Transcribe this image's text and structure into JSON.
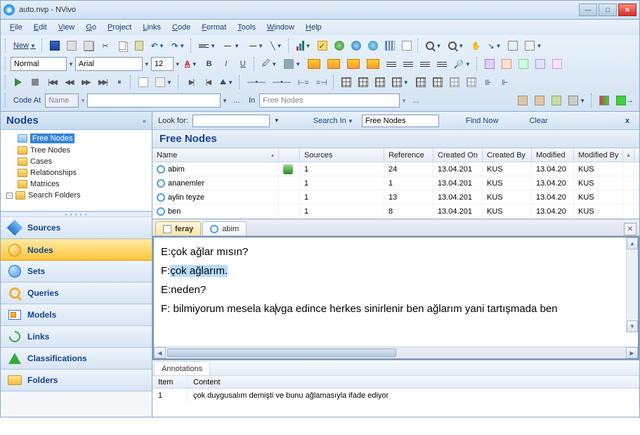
{
  "title": "auto.nvp - NVivo",
  "menubar": [
    "File",
    "Edit",
    "View",
    "Go",
    "Project",
    "Links",
    "Code",
    "Format",
    "Tools",
    "Window",
    "Help"
  ],
  "toolbar": {
    "new_label": "New",
    "style_combo": "Normal",
    "font_combo": "Arial",
    "size_combo": "12",
    "codeat_label": "Code At",
    "codeat_field": "Name",
    "in_label": "In",
    "in_value": "Free Nodes",
    "placeholder_dots": "..."
  },
  "nav": {
    "header": "Nodes",
    "tree": [
      {
        "label": "Free Nodes",
        "icon": "free",
        "selected": true,
        "indent": 1
      },
      {
        "label": "Tree Nodes",
        "icon": "folder",
        "indent": 1
      },
      {
        "label": "Cases",
        "icon": "folder",
        "indent": 1
      },
      {
        "label": "Relationships",
        "icon": "folder",
        "indent": 1
      },
      {
        "label": "Matrices",
        "icon": "folder",
        "indent": 1
      },
      {
        "label": "Search Folders",
        "icon": "folder",
        "indent": 0,
        "expander": "-"
      }
    ],
    "big": [
      {
        "label": "Sources",
        "icon": "diamond"
      },
      {
        "label": "Nodes",
        "icon": "circle",
        "active": true
      },
      {
        "label": "Sets",
        "icon": "circle-b"
      },
      {
        "label": "Queries",
        "icon": "mag"
      },
      {
        "label": "Models",
        "icon": "model"
      },
      {
        "label": "Links",
        "icon": "link"
      },
      {
        "label": "Classifications",
        "icon": "tri"
      },
      {
        "label": "Folders",
        "icon": "folder2"
      }
    ]
  },
  "lookfor": {
    "label": "Look for:",
    "value": "",
    "searchin_label": "Search In",
    "scope_value": "Free Nodes",
    "find_label": "Find Now",
    "clear_label": "Clear"
  },
  "list": {
    "title": "Free Nodes",
    "columns": [
      "Name",
      "",
      "Sources",
      "Reference",
      "Created On",
      "Created By",
      "Modified",
      "Modified By"
    ],
    "rows": [
      {
        "name": "abim",
        "badge": true,
        "sources": "1",
        "ref": "24",
        "con": "13.04.201",
        "cby": "KUS",
        "mod": "13.04.20",
        "mby": "KUS"
      },
      {
        "name": "ananemler",
        "sources": "1",
        "ref": "1",
        "con": "13.04.201",
        "cby": "KUS",
        "mod": "13.04.20",
        "mby": "KUS"
      },
      {
        "name": "aylin teyze",
        "sources": "1",
        "ref": "13",
        "con": "13.04.201",
        "cby": "KUS",
        "mod": "13.04.20",
        "mby": "KUS"
      },
      {
        "name": "ben",
        "sources": "1",
        "ref": "8",
        "con": "13.04.201",
        "cby": "KUS",
        "mod": "13.04.20",
        "mby": "KUS"
      }
    ]
  },
  "tabs": [
    {
      "label": "feray",
      "type": "doc",
      "active": true
    },
    {
      "label": "abim",
      "type": "node"
    }
  ],
  "doc": {
    "lines": [
      {
        "pre": "E:çok ağlar mısın?"
      },
      {
        "pre": "F:",
        "hl": "çok ağlarım."
      },
      {
        "pre": "E:neden?"
      },
      {
        "pre": "F: bilmiyorum mesela ka",
        "cursor": true,
        "post": "vga edince herkes sinirlenir ben ağlarım yani tartışmada ben"
      }
    ]
  },
  "annotations": {
    "tab_label": "Annotations",
    "columns": [
      "Item",
      "Content"
    ],
    "rows": [
      {
        "item": "1",
        "content": "çok duygusalım demişti ve bunu ağlamasıyla ifade ediyor"
      }
    ]
  }
}
